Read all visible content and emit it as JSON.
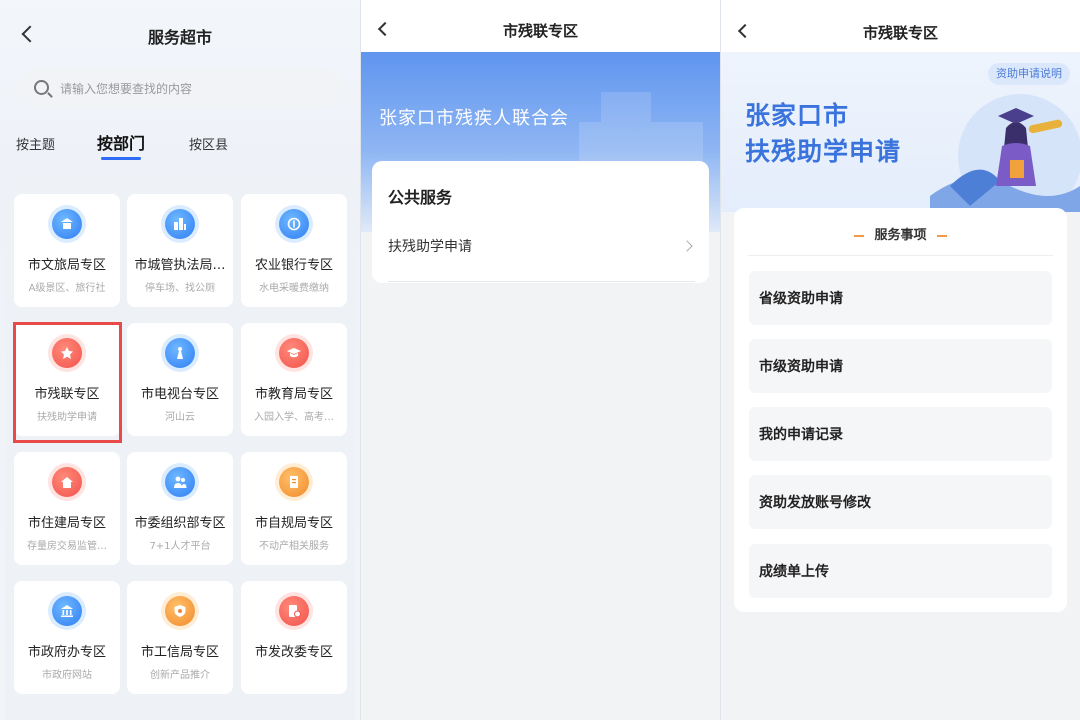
{
  "screen1": {
    "title": "服务超市",
    "search_placeholder": "请输入您想要查找的内容",
    "tabs": [
      {
        "label": "按主题",
        "active": false
      },
      {
        "label": "按部门",
        "active": true
      },
      {
        "label": "按区县",
        "active": false
      }
    ],
    "departments": [
      {
        "name": "市文旅局专区",
        "sub": "A级景区、旅行社",
        "icon": "temple-icon",
        "color": "blue"
      },
      {
        "name": "市城管执法局…",
        "sub": "停车场、找公厕",
        "icon": "buildings-icon",
        "color": "blue"
      },
      {
        "name": "农业银行专区",
        "sub": "水电采暖费缴纳",
        "icon": "bank-coin-icon",
        "color": "blue"
      },
      {
        "name": "市残联专区",
        "sub": "扶残助学申请",
        "icon": "disability-emblem-icon",
        "color": "red",
        "highlighted": true
      },
      {
        "name": "市电视台专区",
        "sub": "河山云",
        "icon": "tv-tower-icon",
        "color": "blue"
      },
      {
        "name": "市教育局专区",
        "sub": "入园入学、高考…",
        "icon": "graduation-cap-icon",
        "color": "red"
      },
      {
        "name": "市住建局专区",
        "sub": "存量房交易监管…",
        "icon": "house-icon",
        "color": "red"
      },
      {
        "name": "市委组织部专区",
        "sub": "7+1人才平台",
        "icon": "people-icon",
        "color": "blue"
      },
      {
        "name": "市自规局专区",
        "sub": "不动产相关服务",
        "icon": "document-icon",
        "color": "orange"
      },
      {
        "name": "市政府办专区",
        "sub": "市政府网站",
        "icon": "government-building-icon",
        "color": "blue"
      },
      {
        "name": "市工信局专区",
        "sub": "创新产品推介",
        "icon": "shield-icon",
        "color": "orange"
      },
      {
        "name": "市发改委专区",
        "sub": "",
        "icon": "document-chart-icon",
        "color": "red"
      }
    ]
  },
  "screen2": {
    "title": "市残联专区",
    "banner_org": "张家口市残疾人联合会",
    "section_title": "公共服务",
    "items": [
      {
        "label": "扶残助学申请"
      }
    ]
  },
  "screen3": {
    "title": "市残联专区",
    "help_button": "资助申请说明",
    "banner_line1": "张家口市",
    "banner_line2": "扶残助学申请",
    "services_header": "服务事项",
    "services": [
      {
        "label": "省级资助申请"
      },
      {
        "label": "市级资助申请"
      },
      {
        "label": "我的申请记录"
      },
      {
        "label": "资助发放账号修改"
      },
      {
        "label": "成绩单上传"
      }
    ]
  },
  "colors": {
    "accent_blue": "#2f6cf6",
    "highlight_red": "#e84a4a",
    "banner_blue": "#5f95ef",
    "title_blue": "#3a73dc"
  }
}
